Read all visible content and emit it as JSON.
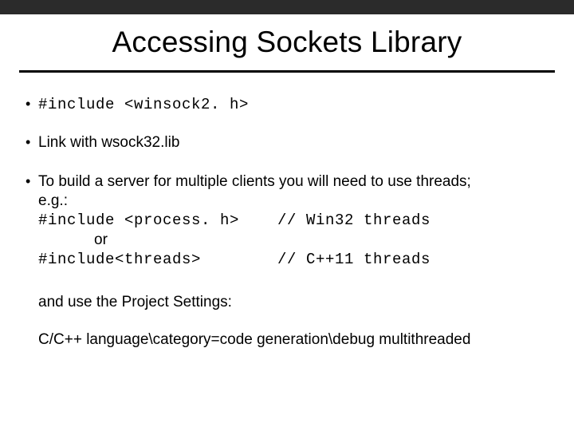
{
  "title": "Accessing Sockets Library",
  "bullets": {
    "b1": {
      "include": "#include <winsock2. h>"
    },
    "b2": {
      "text": "Link with wsock32.lib"
    },
    "b3": {
      "intro_line1": "To build a server for multiple clients you will need to use threads;",
      "intro_line2": "e.g.:",
      "inc1": "#include <process. h>",
      "inc1_comment": "// Win32 threads",
      "or": "or",
      "inc2": "#include<threads>",
      "inc2_comment": "// C++11 threads",
      "settings_intro": "and use the Project Settings:",
      "settings_path": "C/C++ language\\category=code generation\\debug multithreaded"
    }
  }
}
